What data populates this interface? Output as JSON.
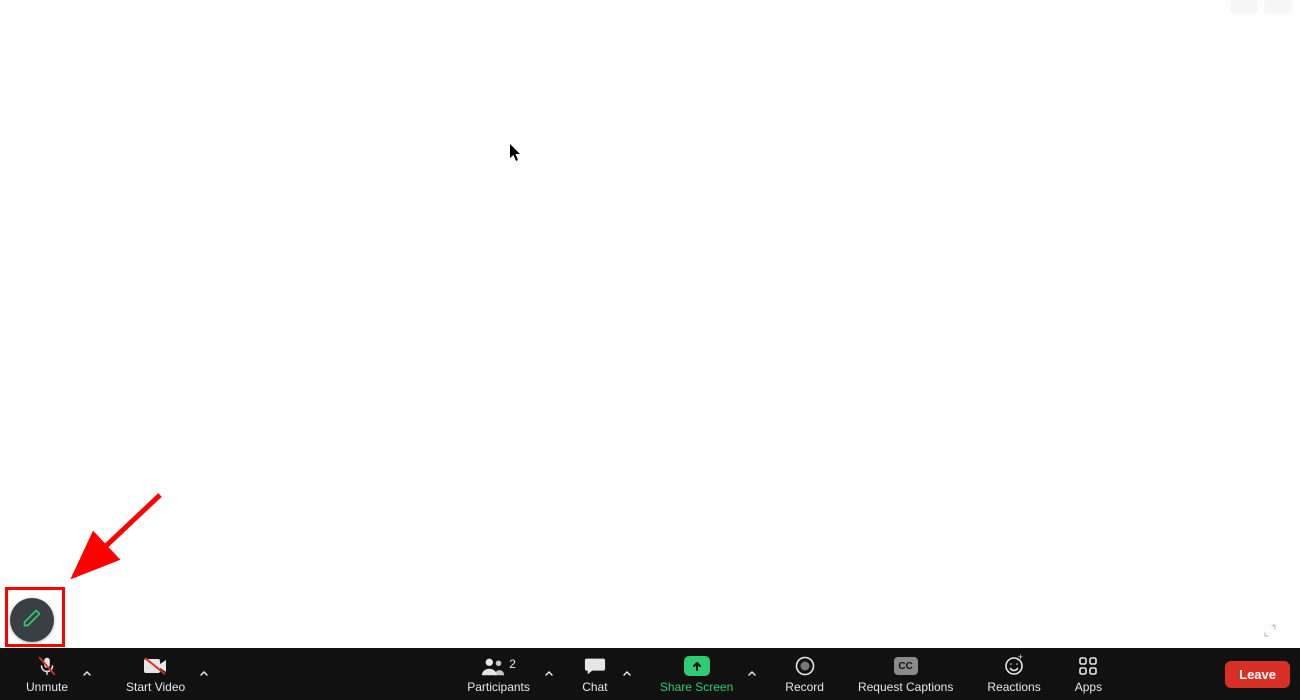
{
  "toolbar": {
    "unmute": "Unmute",
    "start_video": "Start Video",
    "participants": "Participants",
    "participants_count": "2",
    "chat": "Chat",
    "share_screen": "Share Screen",
    "record": "Record",
    "request_captions": "Request Captions",
    "captions_abbrev": "CC",
    "reactions": "Reactions",
    "apps": "Apps",
    "leave": "Leave"
  },
  "colors": {
    "toolbar_bg": "#111111",
    "share_green": "#2ecc71",
    "leave_red": "#d93025",
    "highlight_red": "#ff0000",
    "pencil_green": "#2ecc71"
  }
}
